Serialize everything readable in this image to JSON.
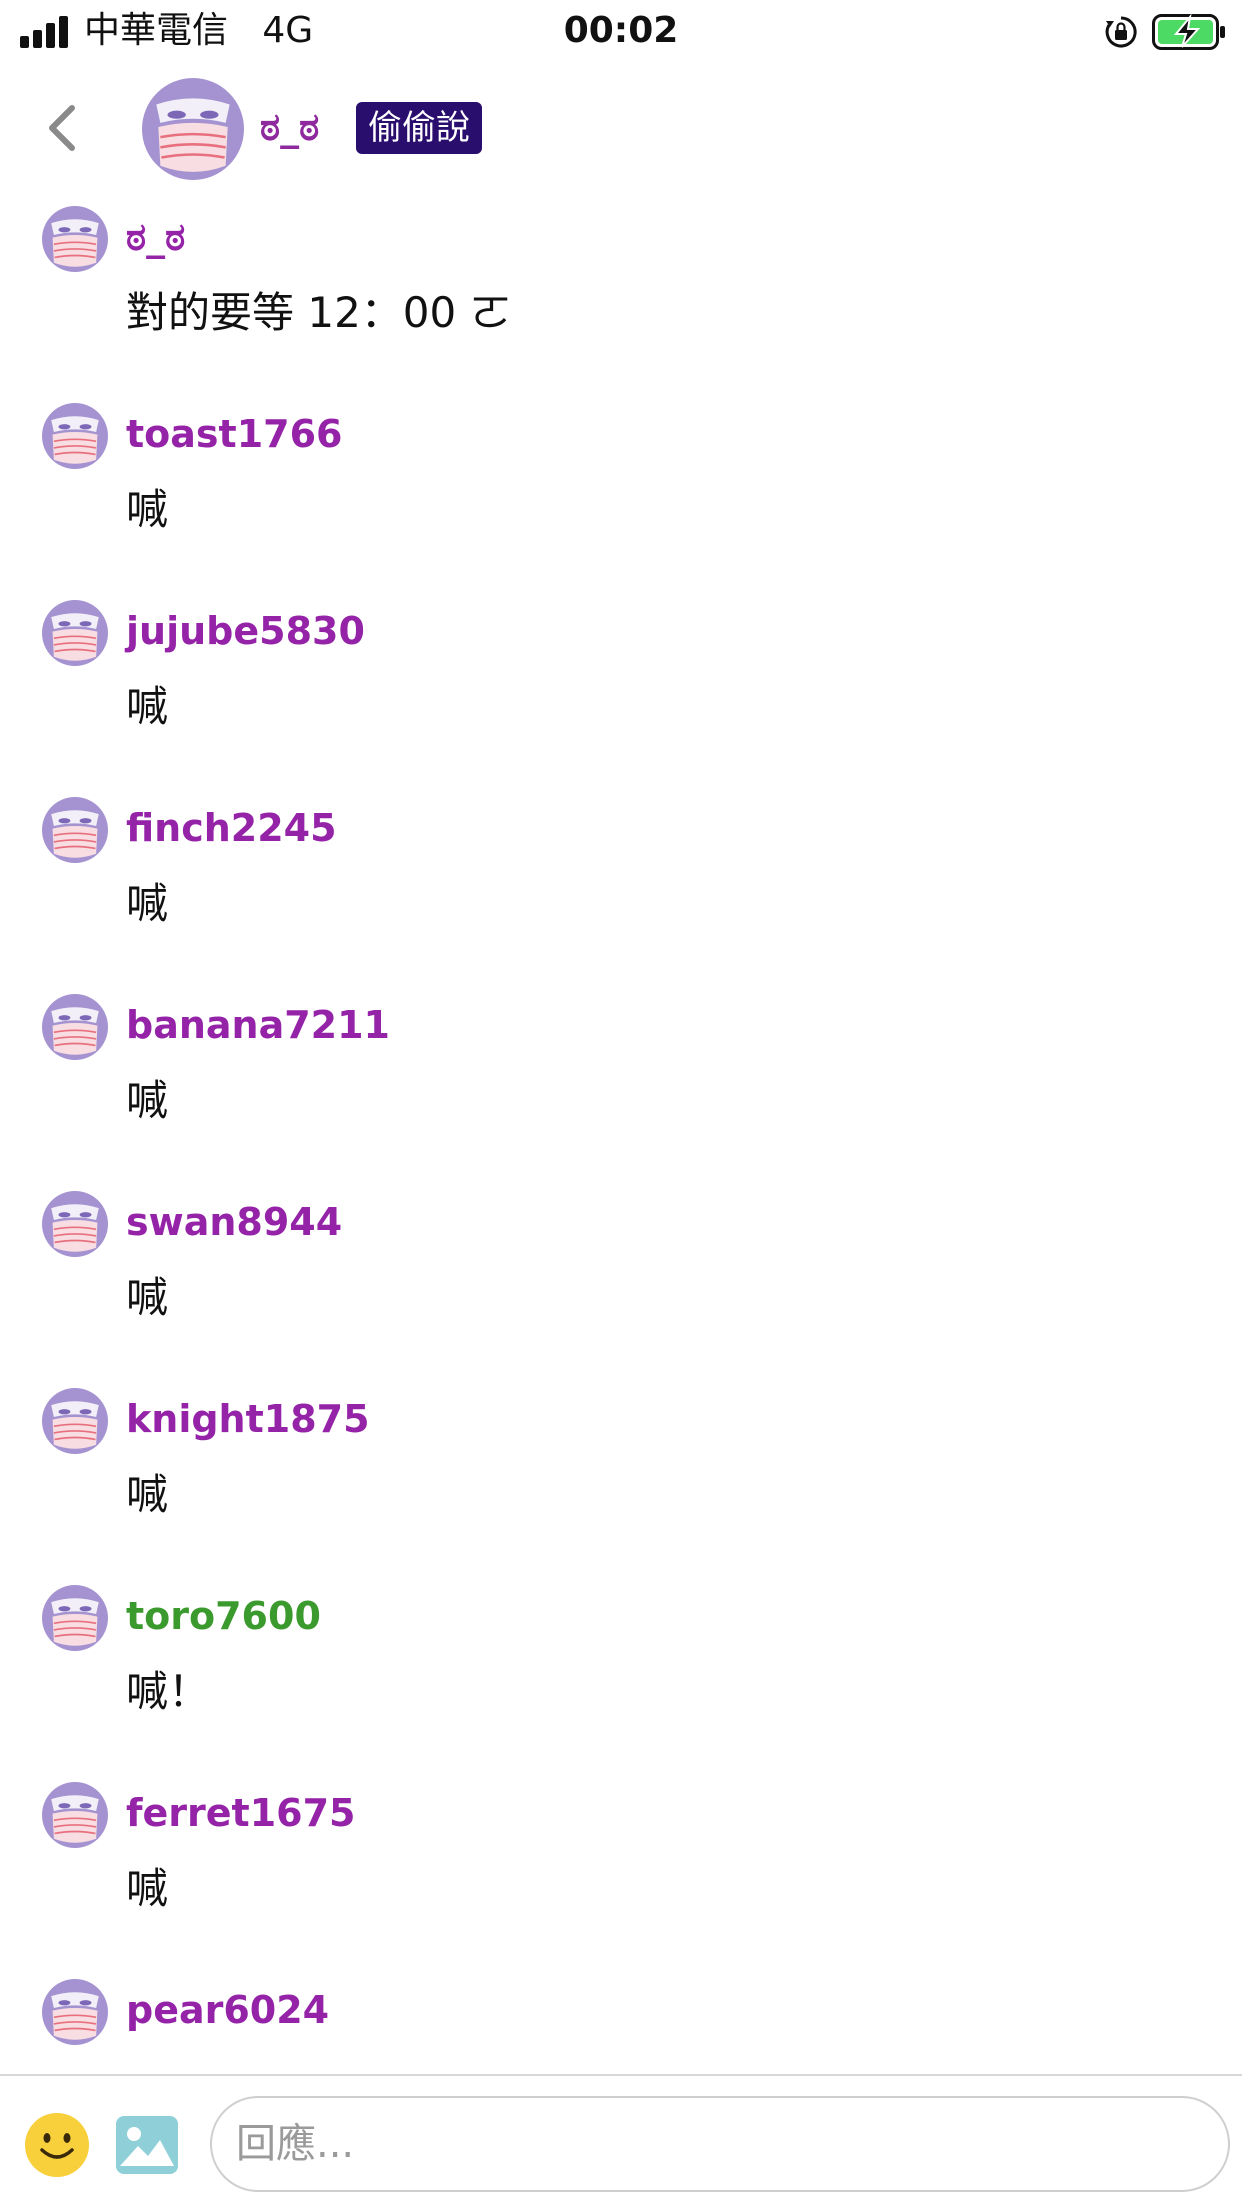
{
  "status_bar": {
    "carrier": "中華電信   4G",
    "time": "00:02",
    "icons": [
      "signal-icon",
      "rotation-lock-icon",
      "battery-charging-icon"
    ]
  },
  "header": {
    "back_icon": "chevron-left-icon",
    "title": "ಠ_ಠ",
    "badge": "偷偷說"
  },
  "messages": [
    {
      "user": "ಠ_ಠ",
      "text": "對的要等 12：00 ㄛ",
      "color": "#9423a8"
    },
    {
      "user": "toast1766",
      "text": "喊",
      "color": "#9423a8"
    },
    {
      "user": "jujube5830",
      "text": "喊",
      "color": "#9423a8"
    },
    {
      "user": "finch2245",
      "text": "喊",
      "color": "#9423a8"
    },
    {
      "user": "banana7211",
      "text": "喊",
      "color": "#9423a8"
    },
    {
      "user": "swan8944",
      "text": "喊",
      "color": "#9423a8"
    },
    {
      "user": "knight1875",
      "text": "喊",
      "color": "#9423a8"
    },
    {
      "user": "toro7600",
      "text": "喊！",
      "color": "#3b9a2d"
    },
    {
      "user": "ferret1675",
      "text": "喊",
      "color": "#9423a8"
    },
    {
      "user": "pear6024",
      "text": "",
      "color": "#9423a8"
    }
  ],
  "input_bar": {
    "placeholder": "回應...",
    "emoji_icon": "smiley-icon",
    "image_icon": "image-icon"
  },
  "colors": {
    "username_purple": "#9423a8",
    "username_green": "#3b9a2d",
    "badge_bg": "#2a0e6e",
    "avatar_purple": "#9b87c9",
    "avatar_pink": "#f6d7dc"
  }
}
